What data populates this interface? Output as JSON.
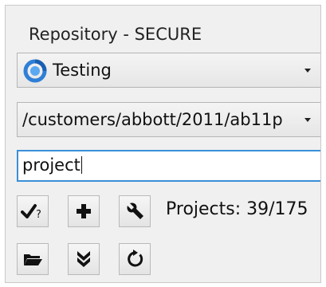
{
  "panel": {
    "title": "Repository - SECURE"
  },
  "repository_select": {
    "value": "Testing",
    "icon": "repository-icon"
  },
  "path_select": {
    "value": "/customers/abbott/2011/ab11p"
  },
  "search": {
    "value": "project"
  },
  "toolbar": {
    "row1": [
      {
        "name": "check-query-button",
        "icon": "check-question-icon"
      },
      {
        "name": "add-button",
        "icon": "plus-icon"
      },
      {
        "name": "settings-button",
        "icon": "wrench-icon"
      }
    ],
    "row2": [
      {
        "name": "open-folder-button",
        "icon": "folder-icon"
      },
      {
        "name": "download-button",
        "icon": "double-chevron-down-icon"
      },
      {
        "name": "refresh-button",
        "icon": "refresh-icon"
      }
    ]
  },
  "projects_count": {
    "text": "Projects: 39/175"
  },
  "colors": {
    "focus_border": "#3a8fd8",
    "panel_bg": "#f0f0f0",
    "repo_icon_blue": "#2f7fd6"
  }
}
